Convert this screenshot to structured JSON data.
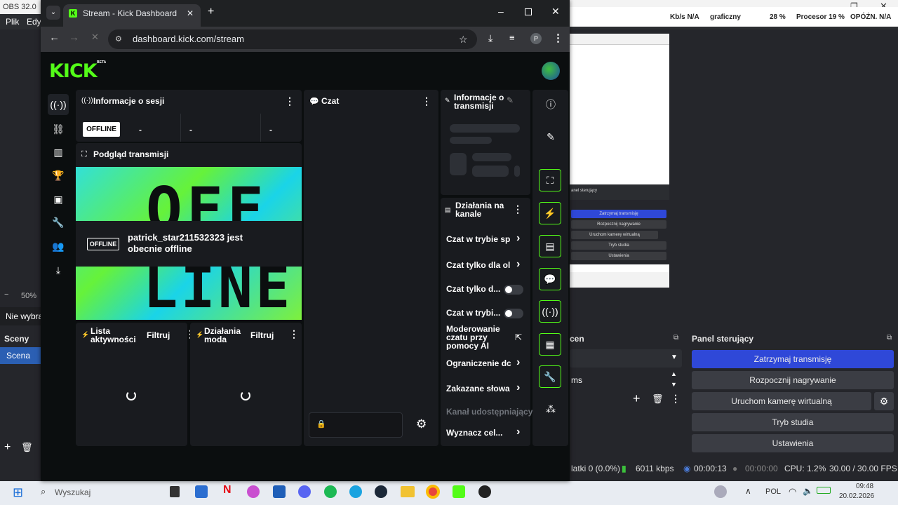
{
  "obs": {
    "title": "OBS 32.0",
    "menu": [
      "Plik",
      "Edy"
    ],
    "stats": {
      "kbs": "Kb/s N/A",
      "graphics": "graficzny",
      "pct1": "28 %",
      "cpu": "Procesor 19 %",
      "delay": "OPÓŹN. N/A"
    },
    "zoom": "50%",
    "zoom_minus": "−",
    "no_selection": "Nie wybra",
    "scenes_header": "Sceny",
    "scene_item": "Scena",
    "sources_header": "cen",
    "sources_item": "ms",
    "control_panel_header": "Panel sterujący",
    "controls": [
      "Zatrzymaj transmisję",
      "Rozpocznij nagrywanie",
      "Uruchom kamerę wirtualną",
      "Tryb studia",
      "Ustawienia"
    ],
    "preview": {
      "panel": "anel sterujący",
      "buttons": [
        "Zatrzymaj transmisję",
        "Rozpocznij nagrywanie",
        "Uruchom kamerę wirtualną",
        "Tryb studia",
        "Ustawienia"
      ]
    },
    "status": {
      "frames": "latki 0 (0.0%)",
      "kbps": "6011 kbps",
      "live": "00:00:13",
      "rec": "00:00:00",
      "cpu": "CPU: 1.2%",
      "fps": "30.00 / 30.00 FPS"
    }
  },
  "taskbar": {
    "search": "Wyszukaj",
    "lang": "POL",
    "time": "09:48",
    "date": "20.02.2026"
  },
  "browser": {
    "tab_title": "Stream - Kick Dashboard",
    "url": "dashboard.kick.com/stream"
  },
  "kick": {
    "logo": "KICK",
    "beta": "BETA",
    "session": {
      "title": "Informacje o sesji",
      "status": "OFFLINE",
      "stats": [
        "-",
        "-",
        "-"
      ]
    },
    "preview": {
      "title": "Podgląd transmisji",
      "badge": "OFFLINE",
      "message": "patrick_star211532323 jest obecnie offline",
      "bg_top": "OFF",
      "bg_bottom": "LINE"
    },
    "activity": {
      "title": "Lista aktywności",
      "filter": "Filtruj"
    },
    "mod_actions": {
      "title": "Działania moda",
      "filter": "Filtruj"
    },
    "chat": {
      "title": "Czat"
    },
    "stream_info": {
      "title": "Informacje o transmisji"
    },
    "channel_actions": {
      "title": "Działania na kanale",
      "items": [
        "Czat w trybie sp",
        "Czat tylko dla ol",
        "Czat tylko d...",
        "Czat w trybi...",
        "Moderowanie czatu przy pomocy AI",
        "Ograniczenie dc",
        "Zakazane słowa",
        "Kanał udostępniający",
        "Wyznacz cel..."
      ]
    }
  }
}
